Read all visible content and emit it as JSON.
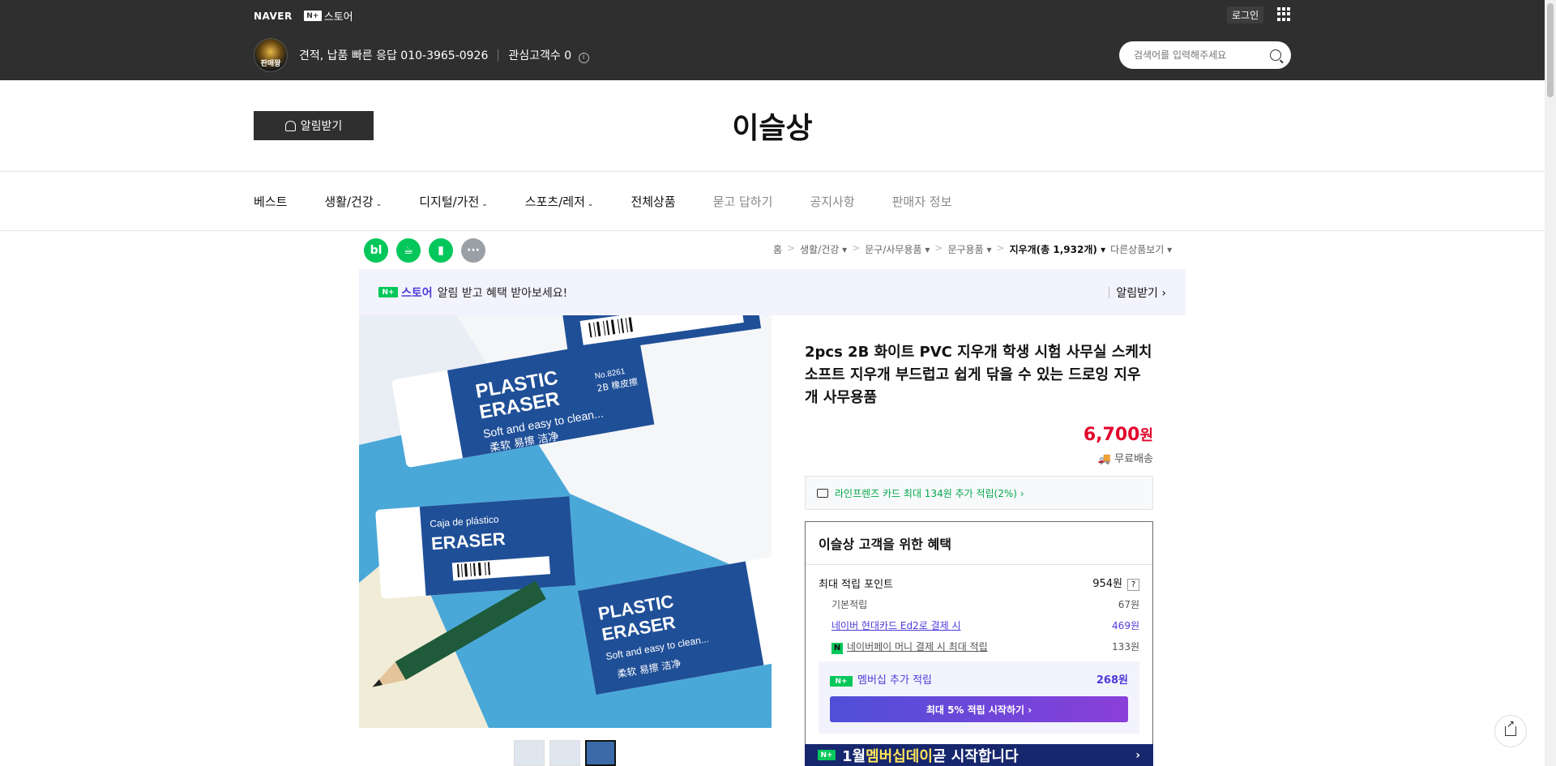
{
  "topbar": {
    "naver": "NAVER",
    "np_badge": "N+",
    "store_label": "스토어",
    "login": "로그인",
    "seller_avatar_text": "판매왕",
    "seller_desc": "견적, 납품 빠른 응답 010-3965-0926",
    "followers": "관심고객수 0",
    "search_placeholder": "검색어를 입력해주세요"
  },
  "header": {
    "alarm_label": "알림받기",
    "store_name": "이슬상"
  },
  "nav": {
    "items": [
      {
        "label": "베스트",
        "caret": "",
        "muted": false
      },
      {
        "label": "생활/건강",
        "caret": "⌄",
        "muted": false
      },
      {
        "label": "디지털/가전",
        "caret": "⌄",
        "muted": false
      },
      {
        "label": "스포츠/레저",
        "caret": "⌄",
        "muted": false
      },
      {
        "label": "전체상품",
        "caret": "",
        "muted": false
      },
      {
        "label": "묻고 답하기",
        "caret": "",
        "muted": true
      },
      {
        "label": "공지사항",
        "caret": "",
        "muted": true
      },
      {
        "label": "판매자 정보",
        "caret": "",
        "muted": true
      }
    ]
  },
  "share": {
    "blog": "bl",
    "cafe": "☕",
    "bookmark": "▮",
    "more": "···"
  },
  "breadcrumb": {
    "home": "홈",
    "c1": "생활/건강",
    "c2": "문구/사무용품",
    "c3": "문구용품",
    "c4": "지우개(총 1,932개)",
    "other": "다른상품보기",
    "gt": ">",
    "caret": "▾"
  },
  "promo": {
    "store": "스토어",
    "text": "알림 받고 혜택 받아보세요!",
    "action": "알림받기 ›"
  },
  "product": {
    "title": "2pcs 2B 화이트 PVC 지우개 학생 시험 사무실 스케치 소프트 지우개 부드럽고 쉽게 닦을 수 있는 드로잉 지우개 사무용품",
    "price": "6,700",
    "won": "원",
    "shipping": "무료배송",
    "card_promo": "라인프렌즈 카드 최대 134원 추가 적립(2%) ›"
  },
  "benefit": {
    "title": "이슬상 고객을 위한 혜택",
    "max_points_label": "최대 적립 포인트",
    "max_points_value": "954원",
    "q": "?",
    "basic_label": "기본적립",
    "basic_value": "67원",
    "card_label": "네이버 현대카드 Ed2로 결제 시",
    "card_value": "469원",
    "npay_label": "네이버페이 머니 결제 시 최대 적립",
    "npay_value": "133원",
    "npay_icon": "N",
    "member_label": "멤버십 추가 적립",
    "member_value": "268원",
    "member_btn": "최대 5% 적립 시작하기 ›"
  },
  "banner": {
    "badge": "N+",
    "pre": "1월 ",
    "hl": "멤버십데이",
    "post": " 곧 시작합니다",
    "arrow": "›"
  },
  "image_text": {
    "t1": "PLASTIC",
    "t2": "ERASER",
    "t3": "Soft and easy to clean...",
    "t4": "柔软  易擦  洁净",
    "t5": "Caja de plástico",
    "t6": "ERASER",
    "t7": "No.8261",
    "t8": "2B 橡皮擦"
  },
  "colors": {
    "topbar": "#2f2f2f",
    "price": "#e1062c",
    "npay_green": "#03c75a",
    "accent_purple": "#4f3bd9"
  }
}
